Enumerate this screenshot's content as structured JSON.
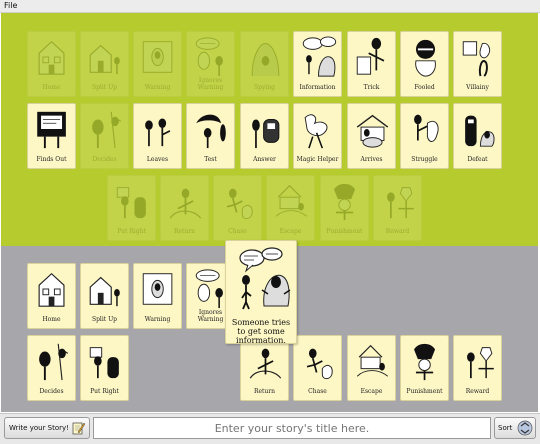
{
  "menu": {
    "file": "File"
  },
  "palette_cards": [
    {
      "id": "home",
      "label": "Home",
      "used": true
    },
    {
      "id": "split-up",
      "label": "Split Up",
      "used": true
    },
    {
      "id": "warning",
      "label": "Warning",
      "used": true
    },
    {
      "id": "ignores-warning",
      "label": "Ignores\nWarning",
      "used": true
    },
    {
      "id": "spying",
      "label": "Spying",
      "used": true
    },
    {
      "id": "information",
      "label": "Information",
      "used": false
    },
    {
      "id": "trick",
      "label": "Trick",
      "used": false
    },
    {
      "id": "fooled",
      "label": "Fooled",
      "used": false
    },
    {
      "id": "villainy",
      "label": "Villainy",
      "used": false
    },
    {
      "id": "finds-out",
      "label": "Finds Out",
      "used": false
    },
    {
      "id": "decides",
      "label": "Decides",
      "used": true
    },
    {
      "id": "leaves",
      "label": "Leaves",
      "used": false
    },
    {
      "id": "test",
      "label": "Test",
      "used": false
    },
    {
      "id": "answer",
      "label": "Answer",
      "used": false
    },
    {
      "id": "magic-helper",
      "label": "Magic Helper",
      "used": false
    },
    {
      "id": "arrives",
      "label": "Arrives",
      "used": false
    },
    {
      "id": "struggle",
      "label": "Struggle",
      "used": false
    },
    {
      "id": "defeat",
      "label": "Defeat",
      "used": false
    },
    {
      "id": "put-right",
      "label": "Put Right",
      "used": true
    },
    {
      "id": "return",
      "label": "Return",
      "used": true
    },
    {
      "id": "chase",
      "label": "Chase",
      "used": true
    },
    {
      "id": "escape",
      "label": "Escape",
      "used": true
    },
    {
      "id": "punishment",
      "label": "Punishment",
      "used": true
    },
    {
      "id": "reward",
      "label": "Reward",
      "used": true
    }
  ],
  "story_cards": [
    {
      "id": "home",
      "label": "Home"
    },
    {
      "id": "split-up",
      "label": "Split Up"
    },
    {
      "id": "warning",
      "label": "Warning"
    },
    {
      "id": "ignores-warning",
      "label": "Ignores\nWarning"
    },
    {
      "id": "decides",
      "label": "Decides"
    },
    {
      "id": "put-right",
      "label": "Put Right"
    },
    {
      "id": "return",
      "label": "Return"
    },
    {
      "id": "chase",
      "label": "Chase"
    },
    {
      "id": "escape",
      "label": "Escape"
    },
    {
      "id": "punishment",
      "label": "Punishment"
    },
    {
      "id": "reward",
      "label": "Reward"
    }
  ],
  "dragging_card": {
    "id": "information",
    "text": "Someone tries to get some information."
  },
  "bottom": {
    "write_label": "Write your Story!",
    "title_placeholder": "Enter your story's title here.",
    "sort_label": "Sort"
  }
}
